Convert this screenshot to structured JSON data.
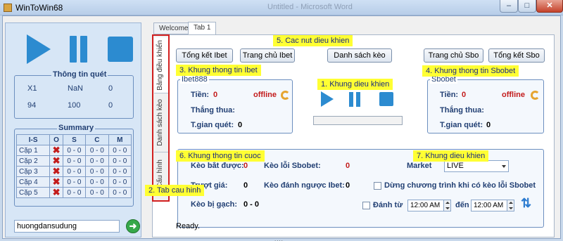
{
  "window": {
    "title": "WinToWin68",
    "ghost_title": "Untitled - Microsoft Word",
    "close_label": "✕",
    "min_label": "–",
    "max_label": "□"
  },
  "left": {
    "scan_title": "Thông tin quét",
    "scan_rows": [
      [
        "X1",
        "NaN",
        "0"
      ],
      [
        "94",
        "100",
        "0"
      ]
    ],
    "summary_title": "Summary",
    "summary_headers": [
      "I-S",
      "O",
      "S",
      "C",
      "M"
    ],
    "summary_rows": [
      {
        "cap": "Cặp 1",
        "s": "0 - 0",
        "c": "0 - 0",
        "m": "0 - 0"
      },
      {
        "cap": "Cặp 2",
        "s": "0 - 0",
        "c": "0 - 0",
        "m": "0 - 0"
      },
      {
        "cap": "Cặp 3",
        "s": "0 - 0",
        "c": "0 - 0",
        "m": "0 - 0"
      },
      {
        "cap": "Cặp 4",
        "s": "0 - 0",
        "c": "0 - 0",
        "m": "0 - 0"
      },
      {
        "cap": "Cặp 5",
        "s": "0 - 0",
        "c": "0 - 0",
        "m": "0 - 0"
      }
    ],
    "search_value": "huongdansudung"
  },
  "tabs": [
    "Welcome",
    "Tab 1"
  ],
  "side_tabs": [
    "Bảng điều khiển",
    "Danh sách kèo",
    "Cấu hình"
  ],
  "buttons": {
    "tong_ket_ibet": "Tổng kết Ibet",
    "trang_chu_ibet": "Trang chủ Ibet",
    "danh_sach_keo": "Danh sách kèo",
    "trang_chu_sbo": "Trang chủ Sbo",
    "tong_ket_sbo": "Tổng kết Sbo"
  },
  "ibet": {
    "title": "Ibet888",
    "tien_label": "Tiền:",
    "tien_value": "0",
    "status": "offline",
    "thang_thua_label": "Thắng thua:",
    "tgian_label": "T.gian quét:",
    "tgian_value": "0"
  },
  "sbo": {
    "title": "Sbobet",
    "tien_label": "Tiền:",
    "tien_value": "0",
    "status": "offline",
    "thang_thua_label": "Thắng thua:",
    "tgian_label": "T.gian quét:",
    "tgian_value": "0"
  },
  "bottom": {
    "keo_bat_duoc_label": "Kèo bắt được:",
    "keo_bat_duoc_value": "0",
    "keo_loi_sbobet_label": "Kèo lỗi Sbobet:",
    "keo_loi_sbobet_value": "0",
    "market_label": "Market",
    "market_value": "LIVE",
    "truot_gia_label": "Trượt giá:",
    "truot_gia_value": "0",
    "keo_danh_nguoc_label": "Kèo đánh ngược Ibet:",
    "keo_danh_nguoc_value": "0",
    "dung_chuong_trinh_label": "Dừng chương trình khi có kèo lỗi Sbobet",
    "keo_bi_gach_label": "Kèo bị gạch:",
    "keo_bi_gach_value": "0 - 0",
    "danh_tu_label": "Đánh từ",
    "time_from": "12:00 AM",
    "den_label": "đến",
    "time_to": "12:00 AM"
  },
  "callouts": {
    "c1": "1. Khung dieu khien",
    "c2": "2. Tab cau hinh",
    "c3": "3. Khung thong tin Ibet",
    "c4": "4. Khung thong tin Sbobet",
    "c5": "5. Cac nut dieu khien",
    "c6": "6. Khung thong tin cuoc",
    "c7": "7. Khung dieu khien"
  },
  "status_text": "Ready.",
  "grip": "....",
  "colors": {
    "accent_blue": "#2c8bd0",
    "callout_yellow": "#ffff33",
    "highlight_red": "#d21f1f"
  }
}
